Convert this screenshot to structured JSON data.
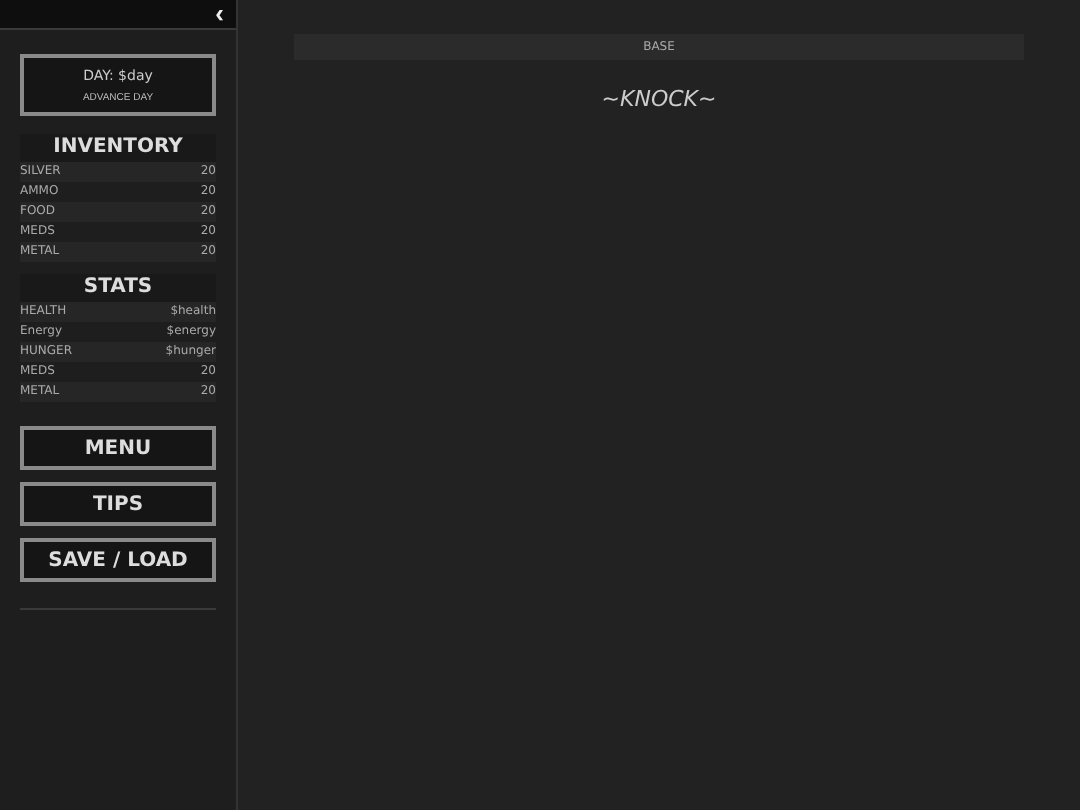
{
  "sidebar": {
    "collapse_icon": "‹",
    "day": {
      "label": "DAY: $day",
      "action": "ADVANCE DAY"
    },
    "inventory": {
      "title": "INVENTORY",
      "rows": [
        {
          "name": "SILVER",
          "value": "20"
        },
        {
          "name": "AMMO",
          "value": "20"
        },
        {
          "name": "FOOD",
          "value": "20"
        },
        {
          "name": "MEDS",
          "value": "20"
        },
        {
          "name": "METAL",
          "value": "20"
        }
      ]
    },
    "stats": {
      "title": "STATS",
      "rows": [
        {
          "name": "HEALTH",
          "value": "$health"
        },
        {
          "name": "Energy",
          "value": "$energy"
        },
        {
          "name": "HUNGER",
          "value": "$hunger"
        },
        {
          "name": "MEDS",
          "value": "20"
        },
        {
          "name": "METAL",
          "value": "20"
        }
      ]
    },
    "buttons": [
      "MENU",
      "TIPS",
      "SAVE / LOAD"
    ]
  },
  "main": {
    "header": "BASE",
    "text": "~KNOCK~"
  }
}
